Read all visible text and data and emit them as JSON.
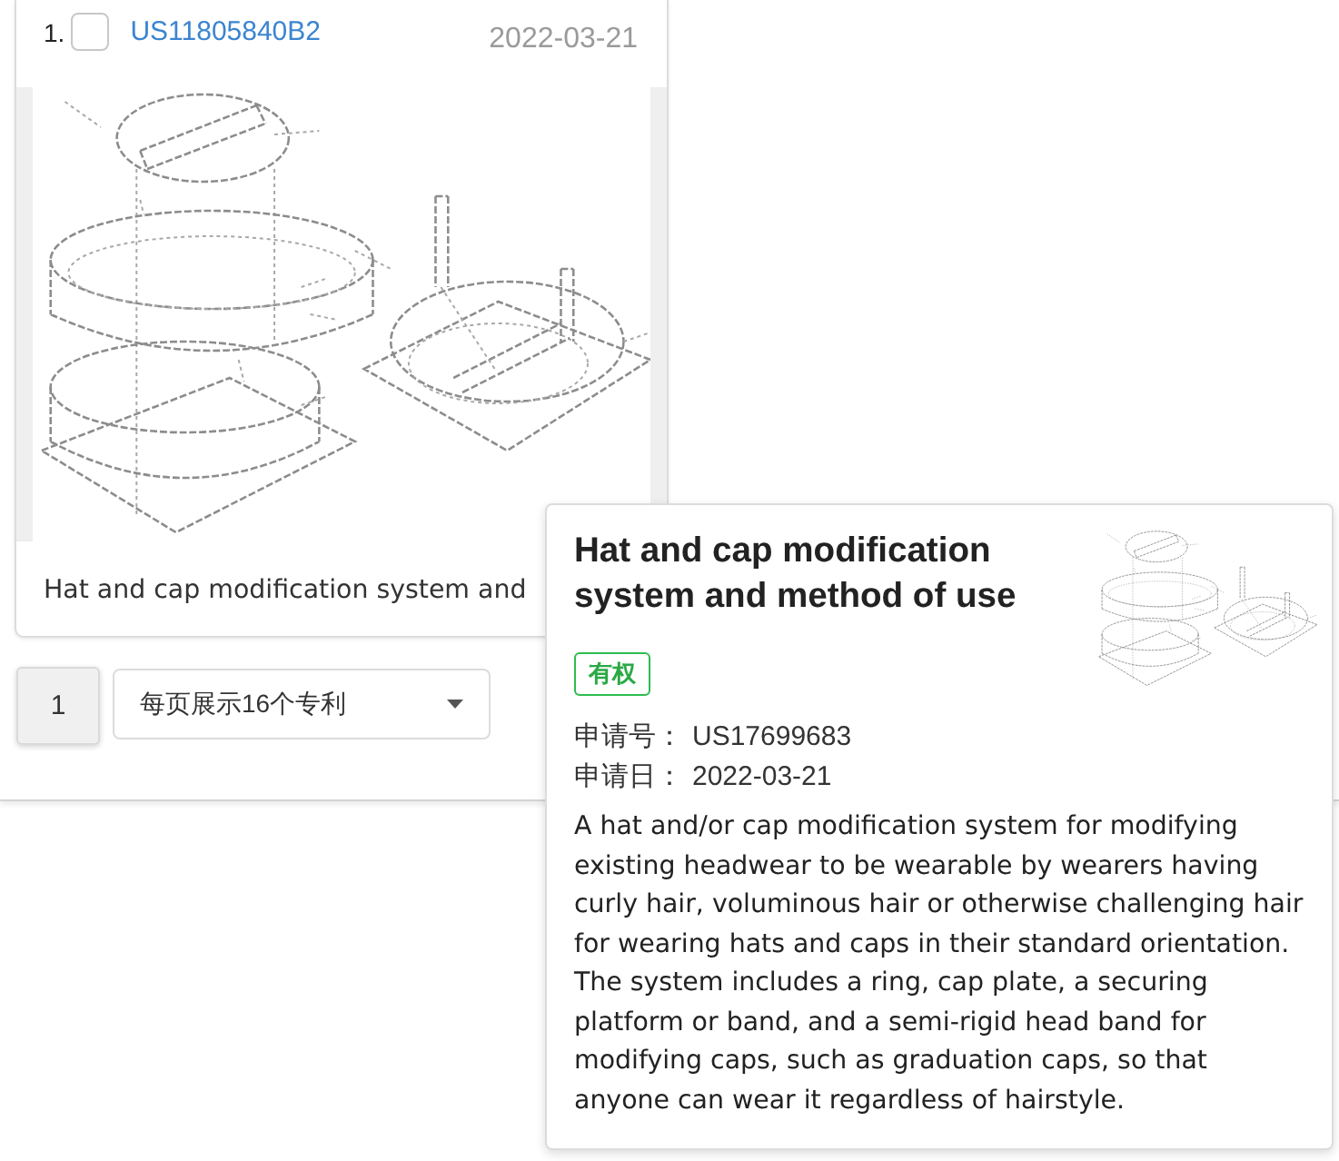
{
  "result_card": {
    "index": "1.",
    "checked": false,
    "patent_number": "US11805840B2",
    "date": "2022-03-21",
    "title": "Hat and cap modification system and"
  },
  "pagination": {
    "pages": [
      {
        "label": "1",
        "selected": true
      }
    ],
    "page_size": "每页展示16个专利"
  },
  "popover": {
    "title": "Hat and cap modification system and method of use",
    "status_tag": "有权",
    "fields": [
      {
        "label": "申请号：",
        "value": "US17699683"
      },
      {
        "label": "申请日：",
        "value": "2022-03-21"
      }
    ],
    "abstract": "A hat and/or cap modification system for modifying existing headwear to be wearable by wearers having curly hair, voluminous hair or otherwise challenging hair for wearing hats and caps in their standard orientation. The system includes a ring, cap plate, a securing platform or band, and a semi-rigid head band for modifying caps, such as graduation caps, so that anyone can wear it regardless of hairstyle."
  }
}
